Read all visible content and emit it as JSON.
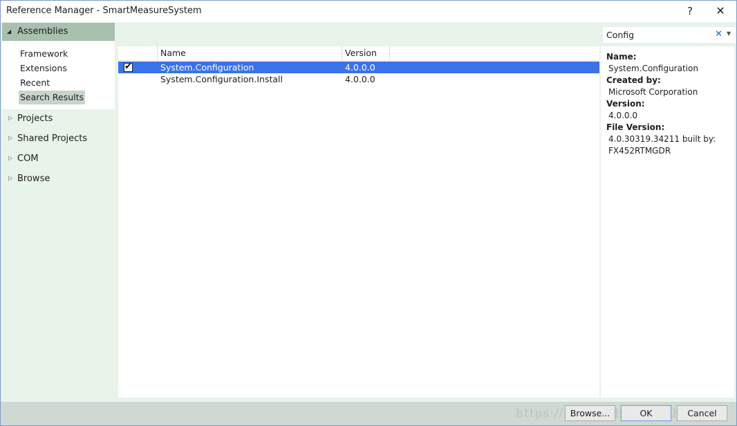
{
  "window": {
    "title": "Reference Manager - SmartMeasureSystem",
    "help_label": "?",
    "close_label": "✕"
  },
  "sidebar": {
    "assemblies": {
      "label": "Assemblies",
      "expand_glyph": "◢"
    },
    "sub_items": [
      {
        "label": "Framework"
      },
      {
        "label": "Extensions"
      },
      {
        "label": "Recent"
      },
      {
        "label": "Search Results",
        "selected": true
      }
    ],
    "nodes": [
      {
        "label": "Projects",
        "glyph": "▷"
      },
      {
        "label": "Shared Projects",
        "glyph": "▷"
      },
      {
        "label": "COM",
        "glyph": "▷"
      },
      {
        "label": "Browse",
        "glyph": "▷"
      }
    ]
  },
  "search": {
    "value": "Config",
    "clear_glyph": "✕",
    "dropdown_glyph": "▼"
  },
  "table": {
    "columns": [
      "",
      "Name",
      "Version"
    ],
    "rows": [
      {
        "checked": true,
        "check_glyph": "✔",
        "name": "System.Configuration",
        "version": "4.0.0.0",
        "selected": true
      },
      {
        "checked": false,
        "name": "System.Configuration.Install",
        "version": "4.0.0.0",
        "selected": false
      }
    ]
  },
  "details": {
    "name_key": "Name:",
    "name_val": "System.Configuration",
    "created_key": "Created by:",
    "created_val": "Microsoft Corporation",
    "version_key": "Version:",
    "version_val": "4.0.0.0",
    "file_version_key": "File Version:",
    "file_version_val1": "4.0.30319.34211 built by:",
    "file_version_val2": "FX452RTMGDR"
  },
  "footer": {
    "browse_label": "Browse...",
    "ok_label": "OK",
    "cancel_label": "Cancel",
    "watermark": "https://blog.csdn.net/sdhongjun"
  },
  "colors": {
    "selection": "#3a72e8",
    "sidebar_bg": "#e8f3ea",
    "header_bg": "#a9bfaf",
    "clear_icon": "#1a66d4"
  }
}
